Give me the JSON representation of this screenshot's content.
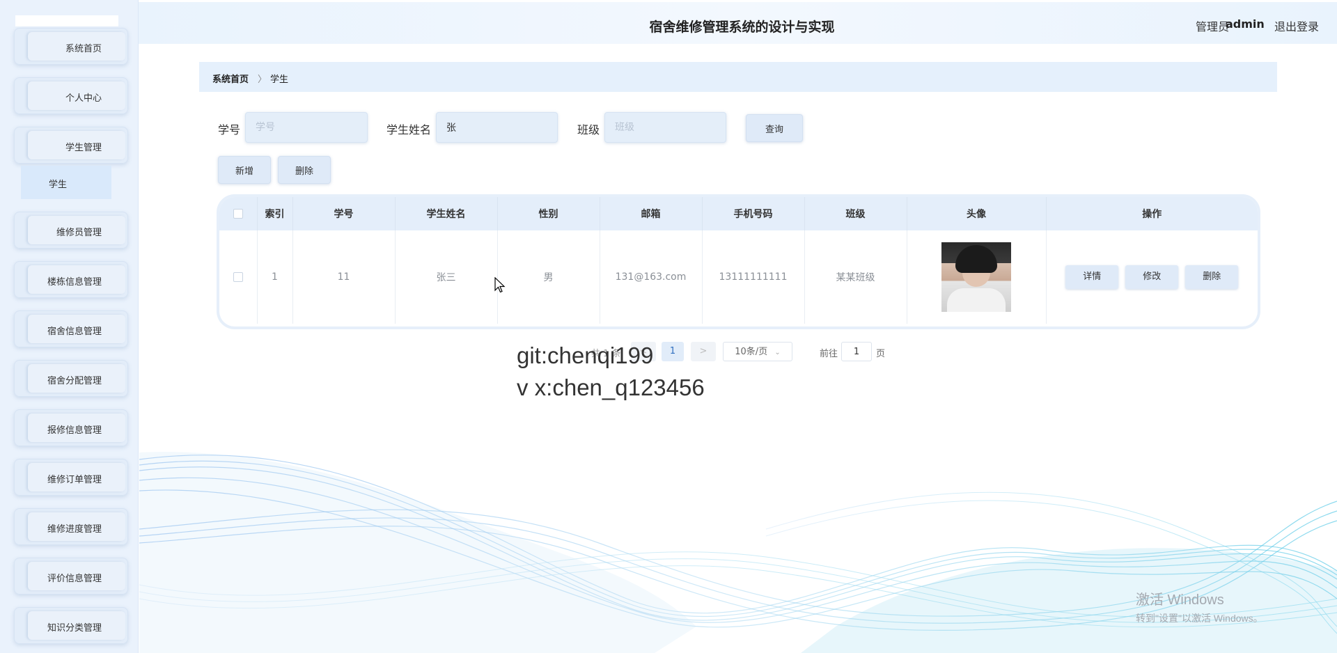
{
  "app": {
    "title": "宿舍维修管理系统的设计与实现",
    "role": "管理员",
    "username": "admin",
    "logout": "退出登录"
  },
  "sidebar": {
    "items": [
      {
        "label": "系统首页"
      },
      {
        "label": "个人中心"
      },
      {
        "label": "学生管理"
      },
      {
        "label": "维修员管理"
      },
      {
        "label": "楼栋信息管理"
      },
      {
        "label": "宿舍信息管理"
      },
      {
        "label": "宿舍分配管理"
      },
      {
        "label": "报修信息管理"
      },
      {
        "label": "维修订单管理"
      },
      {
        "label": "维修进度管理"
      },
      {
        "label": "评价信息管理"
      },
      {
        "label": "知识分类管理"
      }
    ],
    "submenu_active": "学生"
  },
  "breadcrumb": {
    "home": "系统首页",
    "separator": "〉",
    "current": "学生"
  },
  "search": {
    "student_no_label": "学号",
    "student_no_placeholder": "学号",
    "student_no_value": "",
    "name_label": "学生姓名",
    "name_value": "张",
    "class_label": "班级",
    "class_placeholder": "班级",
    "class_value": "",
    "query_button": "查询"
  },
  "actions": {
    "add": "新增",
    "delete": "删除"
  },
  "table": {
    "columns": [
      "索引",
      "学号",
      "学生姓名",
      "性别",
      "邮箱",
      "手机号码",
      "班级",
      "头像",
      "操作"
    ],
    "rows": [
      {
        "index": "1",
        "student_no": "11",
        "name": "张三",
        "gender": "男",
        "email": "131@163.com",
        "phone": "13111111111",
        "class": "某某班级",
        "ops": [
          "详情",
          "修改",
          "删除"
        ]
      }
    ]
  },
  "pagination": {
    "total": "共 1 条",
    "current_page": "1",
    "prev": "<",
    "next": ">",
    "page_size": "10条/页",
    "goto_label": "前往",
    "goto_value": "1",
    "page_suffix": "页"
  },
  "overlay": {
    "line1": "git:chenqi199",
    "line2": "v x:chen_q123456",
    "win_title": "激活 Windows",
    "win_sub": "转到\"设置\"以激活 Windows。"
  },
  "colors": {
    "sidebar_bg": "#eaf2fc",
    "header_bg": "#e9f3fd",
    "button_bg": "#dfeaf8",
    "wave_blue": "#6fa8e8",
    "wave_cyan": "#5fd0e8"
  }
}
